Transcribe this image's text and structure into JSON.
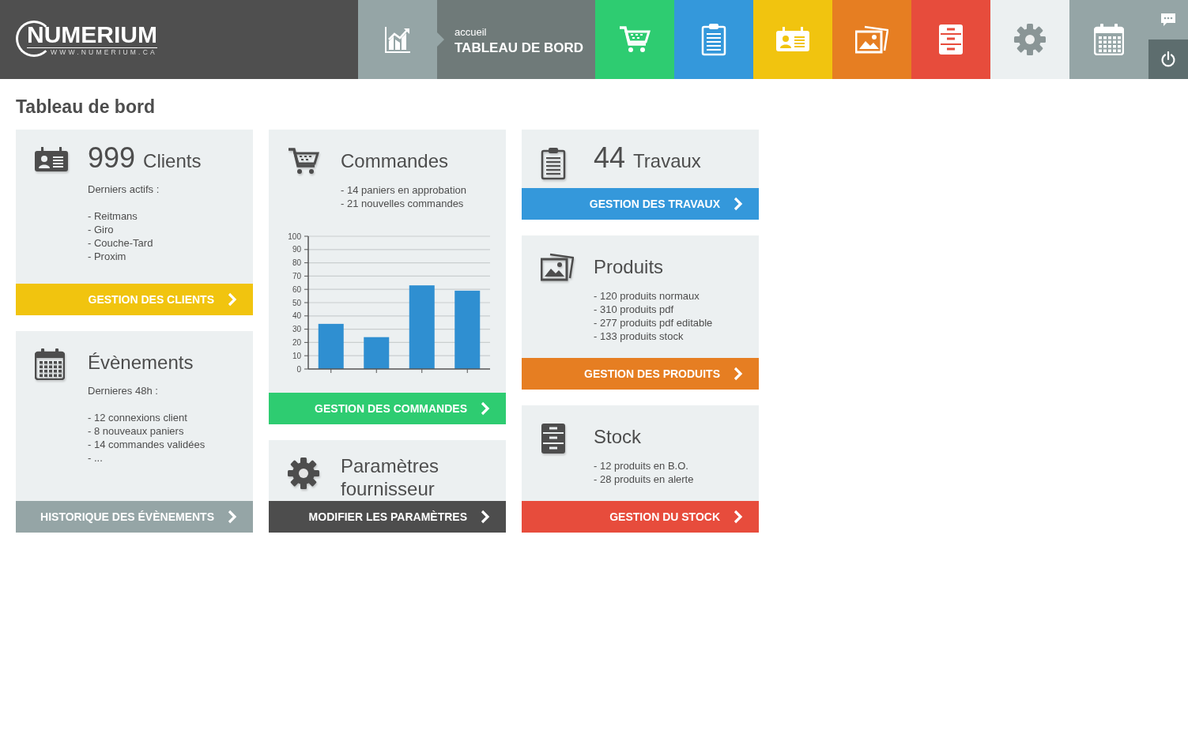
{
  "header": {
    "logo": {
      "name": "NUMERIUM",
      "url": "WWW.NUMERIUM.CA"
    },
    "home_tile": {
      "color": "#95a5a6"
    },
    "breadcrumb": {
      "parent": "accueil",
      "title": "TABLEAU DE BORD"
    },
    "tiles": [
      {
        "color": "#2ecc71"
      },
      {
        "color": "#3498db"
      },
      {
        "color": "#f1c40f"
      },
      {
        "color": "#e67e22"
      },
      {
        "color": "#e74c3c"
      },
      {
        "color": "#ecf0f1"
      },
      {
        "color": "#95a5a6"
      }
    ],
    "side_buttons": [
      {
        "color": "#95a5a6"
      },
      {
        "color": "#5d6d6e"
      }
    ]
  },
  "page_title": "Tableau de bord",
  "columns": [
    [
      {
        "count": "999",
        "title": "Clients",
        "subtitle": "Derniers actifs :",
        "lines": [
          "- Reitmans",
          "- Giro",
          "- Couche-Tard",
          "- Proxim"
        ],
        "button": {
          "label": "GESTION DES CLIENTS",
          "color": "#f1c40f"
        }
      },
      {
        "title": "Évènements",
        "subtitle": "Dernieres 48h :",
        "lines": [
          "- 12 connexions client",
          "- 8 nouveaux paniers",
          "- 14 commandes validées",
          "- ..."
        ],
        "button": {
          "label": "HISTORIQUE DES ÉVÈNEMENTS",
          "color": "#95a5a6"
        }
      }
    ],
    [
      {
        "title": "Commandes",
        "lines": [
          "- 14 paniers en approbation",
          "- 21 nouvelles commandes"
        ],
        "chart_data": {
          "type": "bar",
          "grid": true,
          "values": [
            34,
            24,
            63,
            59
          ],
          "ylim": [
            0,
            100
          ],
          "yticks": [
            0,
            10,
            20,
            30,
            40,
            50,
            60,
            70,
            80,
            90,
            100
          ]
        },
        "button": {
          "label": "GESTION DES COMMANDES",
          "color": "#2ecc71"
        }
      },
      {
        "title": "Paramètres fournisseur",
        "button": {
          "label": "MODIFIER LES PARAMÈTRES",
          "color": "#4d4d4d"
        }
      }
    ],
    [
      {
        "count": "44",
        "title": "Travaux",
        "button": {
          "label": "GESTION DES TRAVAUX",
          "color": "#3498db"
        }
      },
      {
        "title": "Produits",
        "lines": [
          "- 120 produits normaux",
          "- 310 produits pdf",
          "- 277 produits pdf editable",
          "- 133 produits stock"
        ],
        "button": {
          "label": "GESTION DES PRODUITS",
          "color": "#e67e22"
        }
      },
      {
        "title": "Stock",
        "lines": [
          "- 12 produits en B.O.",
          "- 28 produits en alerte"
        ],
        "button": {
          "label": "GESTION DU STOCK",
          "color": "#e74c3c"
        }
      }
    ]
  ]
}
